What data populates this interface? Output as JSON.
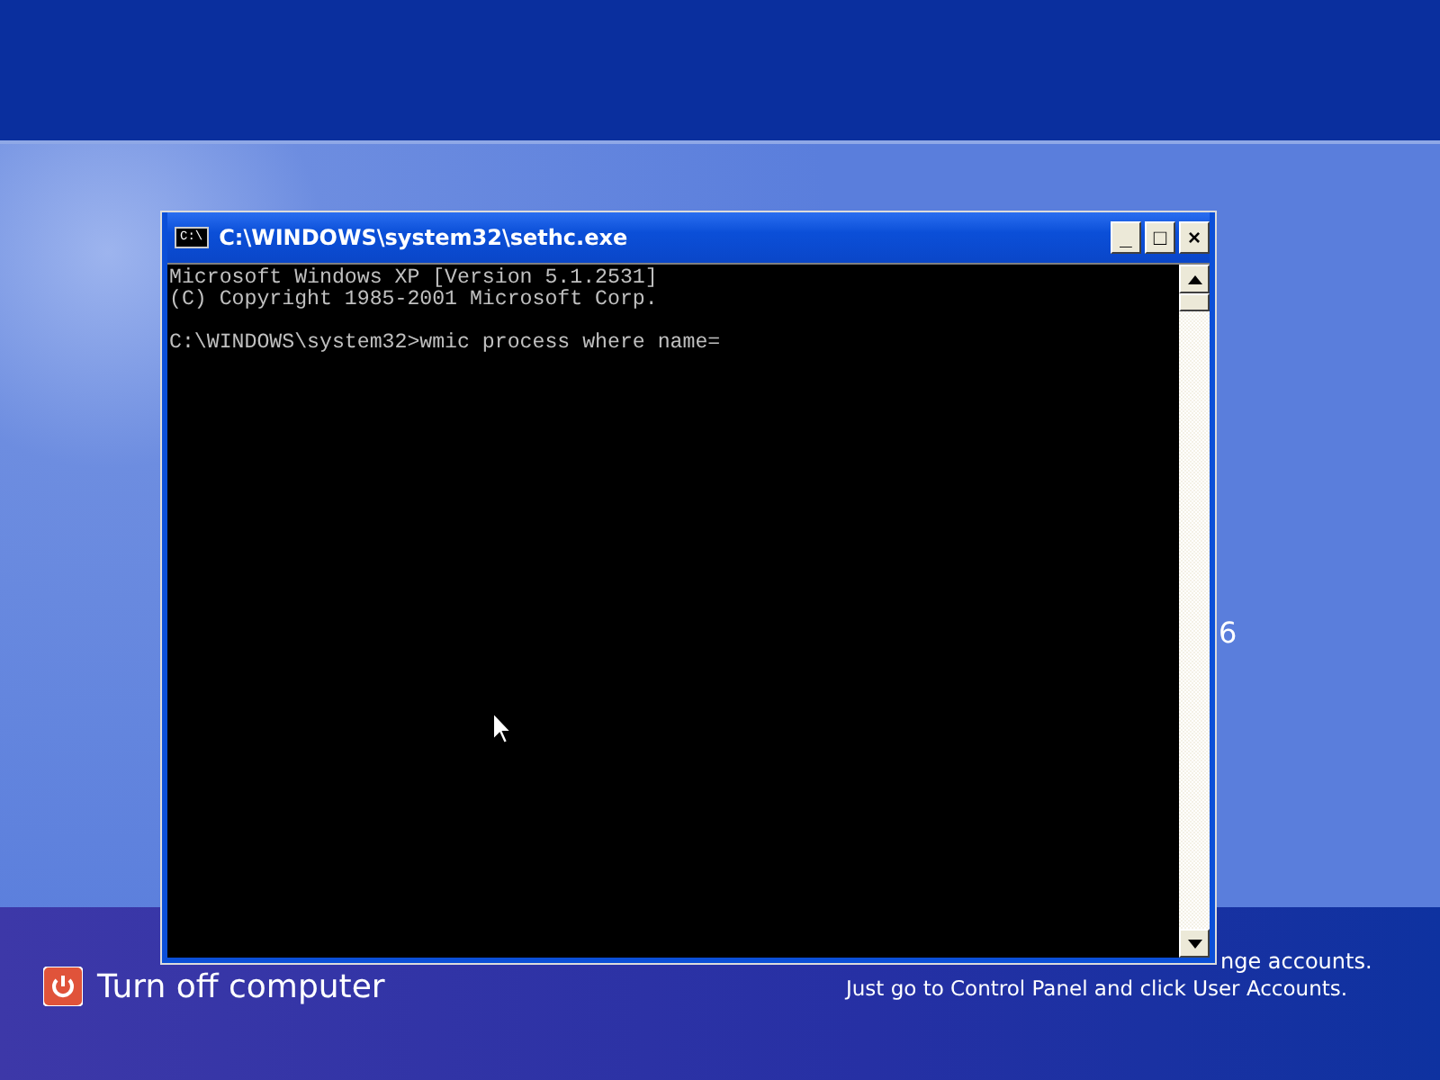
{
  "login_screen": {
    "partial_label": "6",
    "turn_off_label": "Turn off computer",
    "help_lines": [
      "nge accounts.",
      "Just go to Control Panel and click User Accounts."
    ]
  },
  "window": {
    "title": "C:\\WINDOWS\\system32\\sethc.exe",
    "icon_text": "C:\\",
    "buttons": [
      "_",
      "□",
      "×"
    ],
    "console_text": "Microsoft Windows XP [Version 5.1.2531]\n(C) Copyright 1985-2001 Microsoft Corp.\n\nC:\\WINDOWS\\system32>wmic process where name="
  }
}
